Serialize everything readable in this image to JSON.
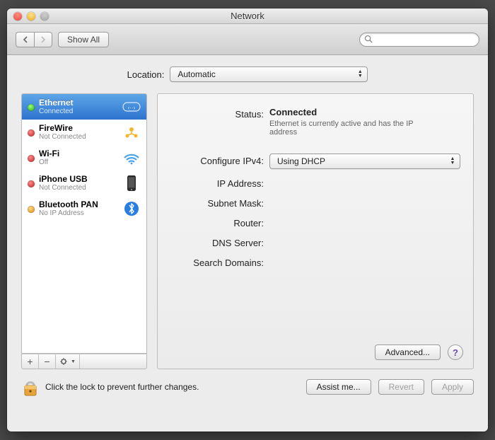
{
  "titlebar": {
    "title": "Network"
  },
  "toolbar": {
    "show_all": "Show All",
    "search_placeholder": ""
  },
  "location": {
    "label": "Location:",
    "selected": "Automatic"
  },
  "sidebar": {
    "services": [
      {
        "name": "Ethernet",
        "sub": "Connected",
        "status": "green",
        "icon": "ethernet-icon",
        "selected": true
      },
      {
        "name": "FireWire",
        "sub": "Not Connected",
        "status": "red",
        "icon": "firewire-icon",
        "selected": false
      },
      {
        "name": "Wi-Fi",
        "sub": "Off",
        "status": "red",
        "icon": "wifi-icon",
        "selected": false
      },
      {
        "name": "iPhone USB",
        "sub": "Not Connected",
        "status": "red",
        "icon": "iphone-icon",
        "selected": false
      },
      {
        "name": "Bluetooth PAN",
        "sub": "No IP Address",
        "status": "orange",
        "icon": "bluetooth-icon",
        "selected": false
      }
    ],
    "footer": {
      "add": "+",
      "remove": "−",
      "gear": "✻▾"
    }
  },
  "detail": {
    "status_label": "Status:",
    "status_value": "Connected",
    "status_desc": "Ethernet is currently active and has the IP address",
    "configure_label": "Configure IPv4:",
    "configure_value": "Using DHCP",
    "ip_label": "IP Address:",
    "subnet_label": "Subnet Mask:",
    "router_label": "Router:",
    "dns_label": "DNS Server:",
    "search_domains_label": "Search Domains:",
    "advanced": "Advanced...",
    "help": "?"
  },
  "bottom": {
    "lock_text": "Click the lock to prevent further changes.",
    "assist": "Assist me...",
    "revert": "Revert",
    "apply": "Apply"
  }
}
